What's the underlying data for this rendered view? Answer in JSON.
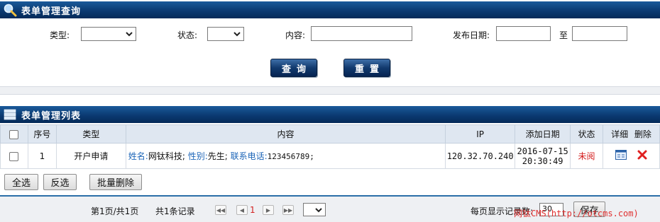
{
  "query_section": {
    "title": "表单管理查询",
    "type_label": "类型:",
    "status_label": "状态:",
    "content_label": "内容:",
    "date_label": "发布日期:",
    "to_label": "至",
    "type_value": "",
    "status_value": "",
    "content_value": "",
    "date_from_value": "",
    "date_to_value": "",
    "search_button": "查询",
    "reset_button": "重置"
  },
  "list_section": {
    "title": "表单管理列表",
    "columns": [
      "序号",
      "类型",
      "内容",
      "IP",
      "添加日期",
      "状态",
      "详细",
      "删除"
    ],
    "rows": [
      {
        "index": "1",
        "type": "开户申请",
        "content": [
          {
            "key": "姓名:",
            "value": "网钛科技;"
          },
          {
            "key": "性别:",
            "value": "先生;"
          },
          {
            "key": "联系电话:",
            "value": "123456789;"
          }
        ],
        "ip": "120.32.70.240",
        "date": "2016-07-15",
        "time": "20:30:49",
        "status": "未阅"
      }
    ]
  },
  "batch": {
    "select_all": "全选",
    "invert": "反选",
    "batch_delete": "批量删除"
  },
  "pager": {
    "page_info": "第1页/共1页",
    "total_info": "共1条记录",
    "current_page": "1",
    "per_page_label": "每页显示记录数:",
    "per_page_value": "30",
    "save_button": "保存"
  },
  "watermark": "网钛CMS(http://otcms.com)",
  "colors": {
    "header_bar": "#0b3a72",
    "table_header": "#dfe7f1",
    "link_blue": "#1e66b8",
    "status_red": "#d42020"
  },
  "icons": {
    "query_title": "magnifier-icon",
    "list_title": "list-icon",
    "detail": "detail-card-icon",
    "delete": "red-x-icon",
    "pager_first": "first-page-icon",
    "pager_prev": "prev-page-icon",
    "pager_next": "next-page-icon",
    "pager_last": "last-page-icon"
  }
}
